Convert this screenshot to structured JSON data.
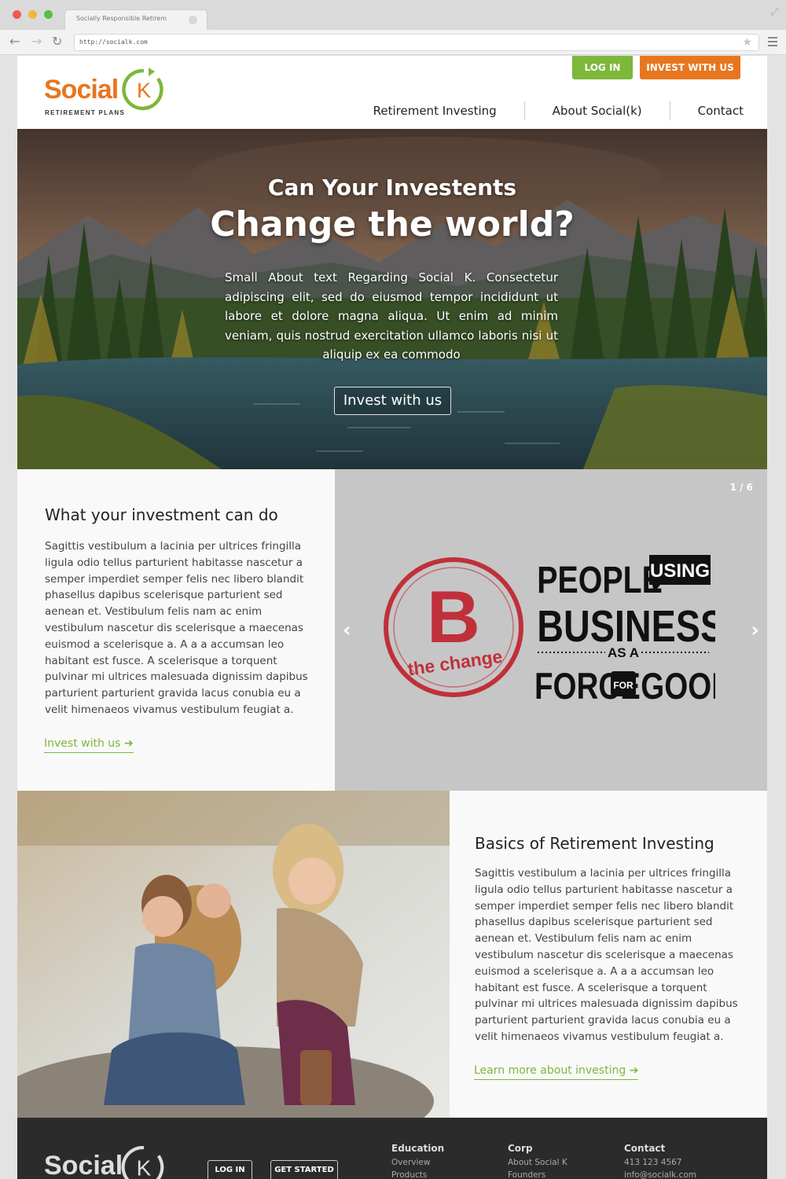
{
  "browser": {
    "tab_title": "Socially Responsible Retirem",
    "url": "http://socialk.com"
  },
  "header": {
    "logo_word": "Social",
    "logo_letter": "K",
    "logo_tagline": "RETIREMENT PLANS",
    "login_label": "LOG IN",
    "invest_label": "INVEST WITH US",
    "nav": [
      "Retirement Investing",
      "About Social(k)",
      "Contact"
    ]
  },
  "hero": {
    "subtitle": "Can Your Investents",
    "title": "Change the world?",
    "text": "Small About text Regarding Social K. Consectetur adipiscing elit, sed do eiusmod tempor incididunt ut labore et dolore magna aliqua. Ut enim ad minim veniam, quis nostrud exercitation ullamco laboris nisi ut aliquip ex ea commodo",
    "button": "Invest with us"
  },
  "section1": {
    "heading": "What your investment can do",
    "body": "Sagittis vestibulum a lacinia per ultrices fringilla ligula odio tellus parturient habitasse nascetur a semper imperdiet semper felis nec libero blandit phasellus dapibus scelerisque parturient sed aenean et. Vestibulum felis nam ac enim vestibulum nascetur dis scelerisque a maecenas euismod a scelerisque a. A a a accumsan leo habitant est fusce. A scelerisque a torquent pulvinar mi ultrices malesuada dignissim dapibus parturient parturient gravida lacus conubia eu a velit himenaeos vivamus vestibulum feugiat a.",
    "link": "Invest with us",
    "carousel": {
      "counter": "1 / 6",
      "stamp_letter": "B",
      "stamp_text": "the change",
      "slogan_people": "PEOPLE",
      "slogan_using": "USING",
      "slogan_business": "BUSINESS",
      "slogan_as_a": "AS A",
      "slogan_force": "FORCE",
      "slogan_for": "FOR",
      "slogan_good": "GOOD"
    }
  },
  "section2": {
    "heading": "Basics of Retirement Investing",
    "body": "Sagittis vestibulum a lacinia per ultrices fringilla ligula odio tellus parturient habitasse nascetur a semper imperdiet semper felis nec libero blandit phasellus dapibus scelerisque parturient sed aenean et. Vestibulum felis nam ac enim vestibulum nascetur dis scelerisque a maecenas euismod a scelerisque a. A a a accumsan leo habitant est fusce. A scelerisque a torquent pulvinar mi ultrices malesuada dignissim dapibus parturient parturient gravida lacus conubia eu a velit himenaeos vivamus vestibulum feugiat a.",
    "link": "Learn more about investing"
  },
  "footer": {
    "logo_word": "Social",
    "logo_letter": "K",
    "login_label": "LOG IN",
    "started_label": "GET STARTED",
    "columns": [
      {
        "heading": "Education",
        "items": [
          "Overview",
          "Products"
        ]
      },
      {
        "heading": "Corp",
        "items": [
          "About Social K",
          "Founders"
        ]
      },
      {
        "heading": "Contact",
        "items": [
          "413 123 4567",
          "info@socialk.com"
        ]
      }
    ]
  },
  "colors": {
    "brand_orange": "#e8761e",
    "brand_green": "#7cb83a",
    "footer_bg": "#2b2b2b",
    "stamp_red": "#c0303a"
  },
  "icons": {
    "back": "arrow-left-icon",
    "forward": "arrow-right-icon",
    "reload": "reload-icon",
    "bookmark": "star-icon",
    "menu": "hamburger-menu-icon",
    "carousel_prev": "chevron-left-icon",
    "carousel_next": "chevron-right-icon",
    "link_arrow": "arrow-right-icon"
  }
}
